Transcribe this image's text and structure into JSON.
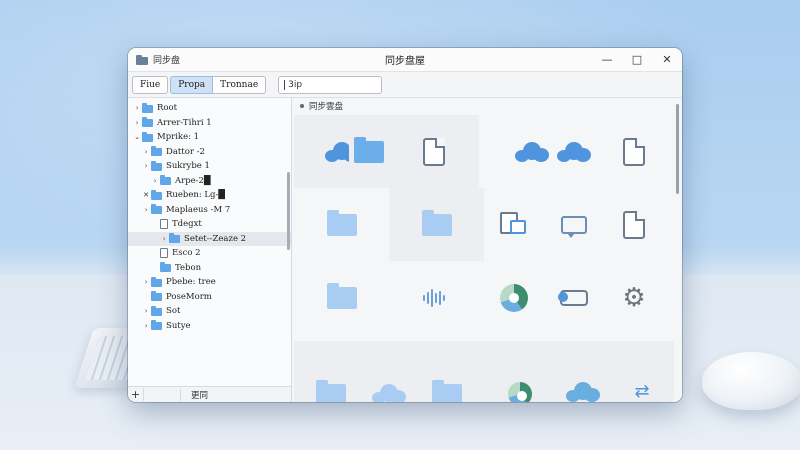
{
  "window": {
    "small_title": "同步盘",
    "title": "同步盘屋",
    "controls": {
      "minimize": "—",
      "maximize": "□",
      "close": "✕"
    }
  },
  "toolbar": {
    "file_label": "Fiue",
    "props_label": "Propa",
    "trans_label": "Tronnae",
    "search_value": "3ip"
  },
  "breadcrumb": {
    "label": "同步雲盘"
  },
  "tree": [
    {
      "label": "Root",
      "arrow": "›",
      "indent": 0,
      "icon": "folder"
    },
    {
      "label": "Arrer-Tihri 1",
      "arrow": "›",
      "indent": 0,
      "icon": "folder"
    },
    {
      "label": "Mprike: 1",
      "arrow": "⌄",
      "indent": 0,
      "icon": "folder"
    },
    {
      "label": "Dattor -2",
      "arrow": "›",
      "indent": 1,
      "icon": "folder"
    },
    {
      "label": "Sukrybe 1",
      "arrow": "›",
      "indent": 1,
      "icon": "folder"
    },
    {
      "label": "Arpe-2█",
      "arrow": "›",
      "indent": 2,
      "icon": "folder"
    },
    {
      "label": "Rueben: Lg-█",
      "arrow": "✕",
      "indent": 1,
      "icon": "folder"
    },
    {
      "label": "Maplaeus -M 7",
      "arrow": "›",
      "indent": 1,
      "icon": "folder"
    },
    {
      "label": "Tdegxt",
      "arrow": "",
      "indent": 2,
      "icon": "doc"
    },
    {
      "label": "Setet--Zeaze 2",
      "arrow": "›",
      "indent": 3,
      "icon": "folder",
      "selected": true
    },
    {
      "label": "Esco 2",
      "arrow": "",
      "indent": 2,
      "icon": "doc"
    },
    {
      "label": "Tebon",
      "arrow": "",
      "indent": 2,
      "icon": "folder"
    },
    {
      "label": "Pbebe: tree",
      "arrow": "›",
      "indent": 1,
      "icon": "folder"
    },
    {
      "label": "PoseMorm",
      "arrow": "",
      "indent": 1,
      "icon": "folder"
    },
    {
      "label": "Sot",
      "arrow": "›",
      "indent": 1,
      "icon": "folder"
    },
    {
      "label": "Sutye",
      "arrow": "›",
      "indent": 1,
      "icon": "folder"
    }
  ],
  "sidebar_footer": {
    "add": "+",
    "label": "更同"
  }
}
